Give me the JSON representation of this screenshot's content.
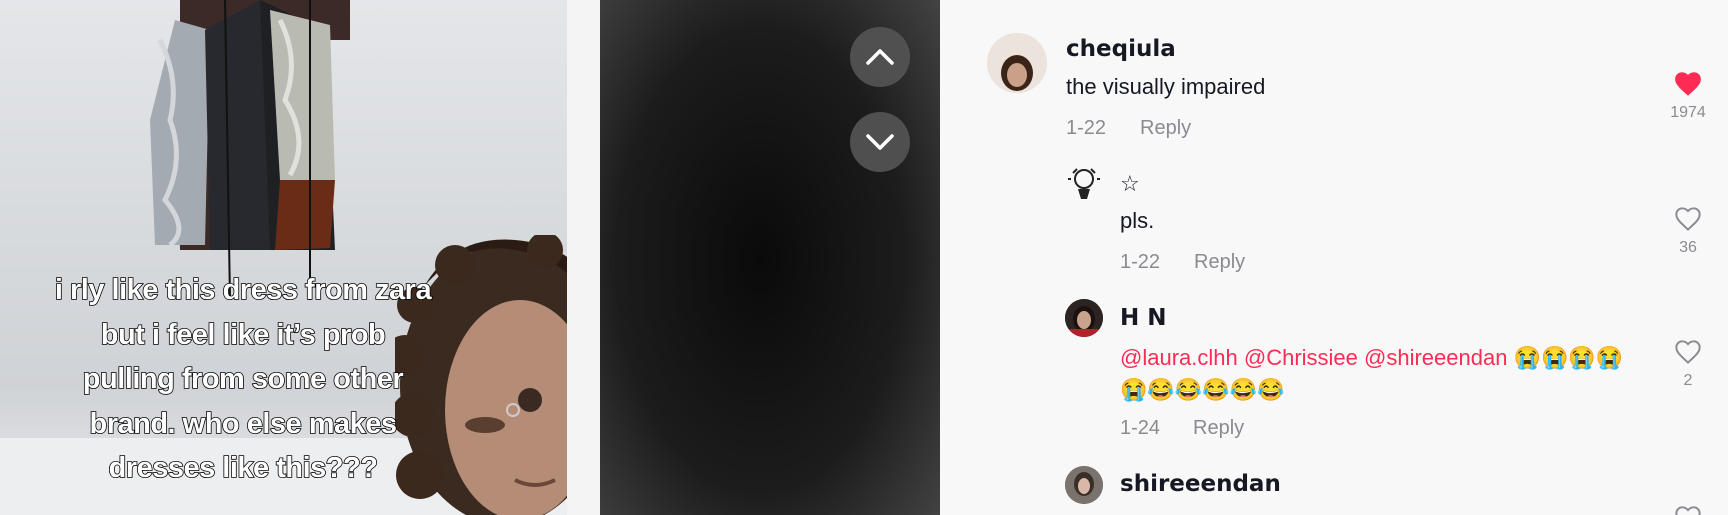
{
  "video": {
    "caption_lines": [
      "i rly like this dress from zara",
      "but i feel like it’s prob",
      "pulling from some other",
      "brand. who else makes",
      "dresses like this???"
    ],
    "nav": {
      "up_icon": "chevron-up-icon",
      "down_icon": "chevron-down-icon"
    }
  },
  "comments": [
    {
      "username": "cheqiula",
      "text": "the visually impaired",
      "date": "1-22",
      "reply_label": "Reply",
      "likes": "1974",
      "liked": true
    },
    {
      "username": "☆",
      "text": "pls.",
      "date": "1-22",
      "reply_label": "Reply",
      "likes": "36",
      "liked": false
    },
    {
      "username": "H N",
      "mentions": [
        "@laura.clhh",
        "@Chrissiee",
        "@shireeendan"
      ],
      "emoji_line1": "😭😭😭😭",
      "emoji_line2": "😭😂😂😂😂😂",
      "date": "1-24",
      "reply_label": "Reply",
      "likes": "2",
      "liked": false
    },
    {
      "username": "shireeendan"
    }
  ],
  "colors": {
    "accent": "#fe2c55",
    "text": "#161823",
    "muted": "#8a8b91"
  }
}
